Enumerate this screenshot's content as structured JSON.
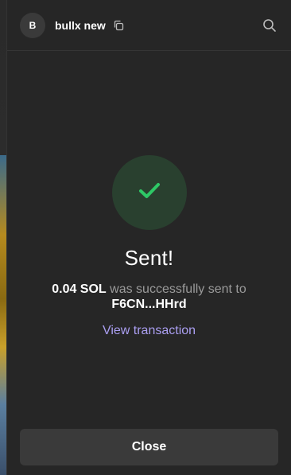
{
  "header": {
    "avatar_letter": "B",
    "wallet_name": "bullx new",
    "copy_icon": "copy-icon",
    "search_icon": "search-icon"
  },
  "status": {
    "icon": "check-icon",
    "title": "Sent!",
    "amount": "0.04 SOL",
    "message_middle": " was successfully sent to ",
    "recipient": "F6CN...HHrd",
    "view_link": "View transaction"
  },
  "footer": {
    "close_label": "Close"
  },
  "colors": {
    "panel_bg": "#262626",
    "success_circle_bg": "#29402f",
    "success_check": "#2ec866",
    "link": "#ab9ff2",
    "button_bg": "#3a3a3a"
  }
}
